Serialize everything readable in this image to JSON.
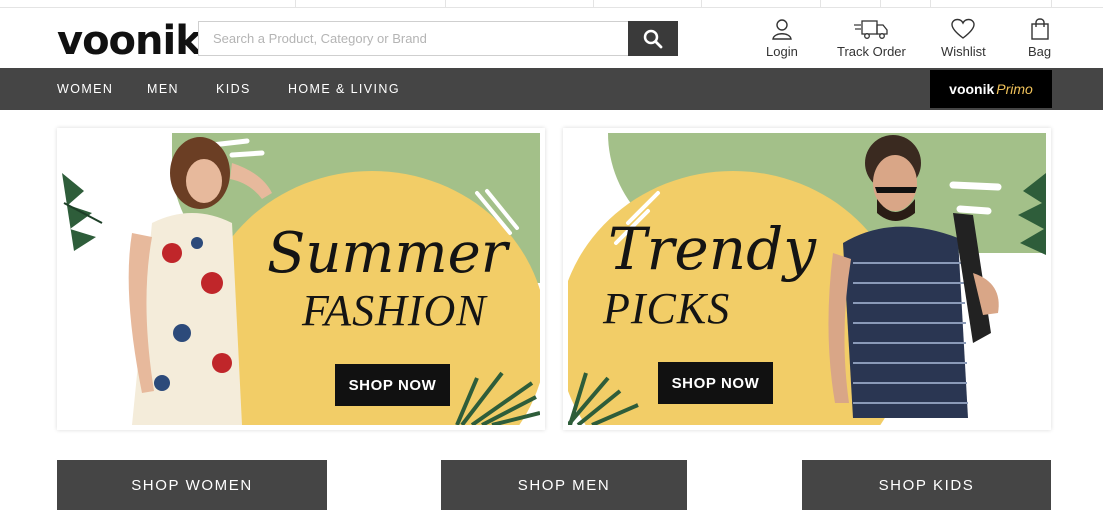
{
  "header": {
    "logo": "voonik",
    "search_placeholder": "Search a Product, Category or Brand",
    "actions": [
      {
        "label": "Login",
        "icon": "user-icon"
      },
      {
        "label": "Track Order",
        "icon": "truck-icon"
      },
      {
        "label": "Wishlist",
        "icon": "heart-icon"
      },
      {
        "label": "Bag",
        "icon": "bag-icon"
      }
    ]
  },
  "nav": {
    "items": [
      "WOMEN",
      "MEN",
      "KIDS",
      "HOME & LIVING"
    ],
    "primo": {
      "brand": "voonik",
      "suffix": "Primo"
    }
  },
  "banners": [
    {
      "title_script": "Summer",
      "title_caps": "FASHION",
      "cta": "SHOP NOW"
    },
    {
      "title_script": "Trendy",
      "title_caps": "PICKS",
      "cta": "SHOP NOW"
    }
  ],
  "categories": [
    "SHOP WOMEN",
    "SHOP MEN",
    "SHOP KIDS"
  ],
  "colors": {
    "nav_bg": "#454545",
    "banner_green": "#a3c089",
    "banner_yellow": "#f2cd67",
    "primo_gold": "#f0c25a"
  }
}
